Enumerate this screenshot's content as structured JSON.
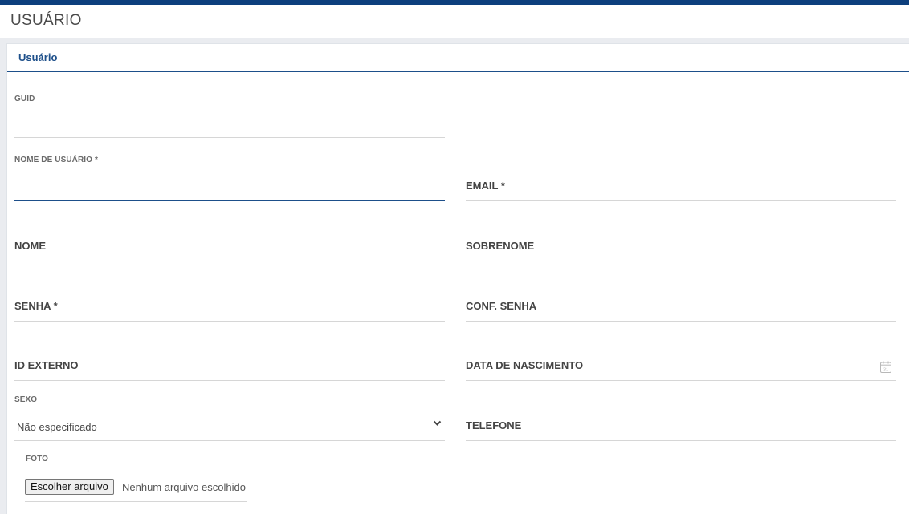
{
  "header": {
    "title": "USUÁRIO"
  },
  "card": {
    "title": "Usuário"
  },
  "fields": {
    "guid": {
      "label": "GUID",
      "value": ""
    },
    "username": {
      "label": "NOME DE USUÁRIO",
      "required": "*",
      "value": ""
    },
    "email": {
      "label": "EMAIL",
      "required": "*",
      "value": ""
    },
    "first_name": {
      "label": "NOME",
      "value": ""
    },
    "last_name": {
      "label": "SOBRENOME",
      "value": ""
    },
    "password": {
      "label": "SENHA",
      "required": "*",
      "value": ""
    },
    "confirm_password": {
      "label": "CONF. SENHA",
      "value": ""
    },
    "external_id": {
      "label": "ID EXTERNO",
      "value": ""
    },
    "birth_date": {
      "label": "DATA DE NASCIMENTO",
      "value": "",
      "icon": "calendar-icon"
    },
    "sex": {
      "label": "SEXO",
      "selected": "Não especificado",
      "icon": "chevron-down-icon"
    },
    "phone": {
      "label": "TELEFONE",
      "value": ""
    },
    "photo": {
      "label": "FOTO",
      "button_label": "Escolher arquivo",
      "status": "Nenhum arquivo escolhido"
    }
  },
  "colors": {
    "primary": "#1d4f8a",
    "topbar": "#0d3f7d",
    "background": "#eaecf0"
  }
}
